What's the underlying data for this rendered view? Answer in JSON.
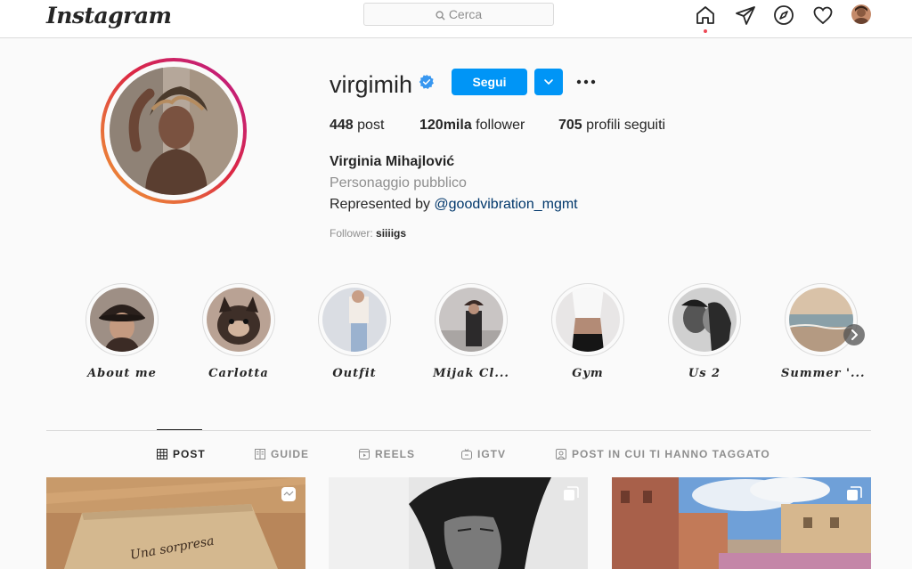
{
  "header": {
    "logo": "Instagram",
    "search_placeholder": "Cerca",
    "icons": [
      "home-icon",
      "direct-icon",
      "explore-icon",
      "activity-icon",
      "profile-avatar"
    ]
  },
  "profile": {
    "username": "virgimih",
    "follow_label": "Segui",
    "stats": {
      "posts_count": "448",
      "posts_label": "post",
      "followers_count": "120mila",
      "followers_label": "follower",
      "following_count": "705",
      "following_label": "profili seguiti"
    },
    "full_name": "Virginia Mihajlović",
    "category": "Personaggio pubblico",
    "bio_text": "Represented by ",
    "bio_mention": "@goodvibration_mgmt",
    "followed_by_label": "Follower: ",
    "followed_by_user": "siiiigs"
  },
  "highlights": [
    {
      "label": "About me"
    },
    {
      "label": "Carlotta"
    },
    {
      "label": "Outfit"
    },
    {
      "label": "Mijak Cl..."
    },
    {
      "label": "Gym"
    },
    {
      "label": "Us 2"
    },
    {
      "label": "Summer '..."
    }
  ],
  "tabs": [
    {
      "label": "POST",
      "active": true
    },
    {
      "label": "GUIDE",
      "active": false
    },
    {
      "label": "REELS",
      "active": false
    },
    {
      "label": "IGTV",
      "active": false
    },
    {
      "label": "POST IN CUI TI HANNO TAGGATO",
      "active": false
    }
  ],
  "posts": [
    {
      "type": "reel",
      "caption_visible": "Una sorpresa"
    },
    {
      "type": "carousel"
    },
    {
      "type": "carousel"
    }
  ],
  "colors": {
    "accent": "#0095f6",
    "verified": "#3897f0",
    "notification_dot": "#ed4956",
    "mention": "#00376b"
  }
}
